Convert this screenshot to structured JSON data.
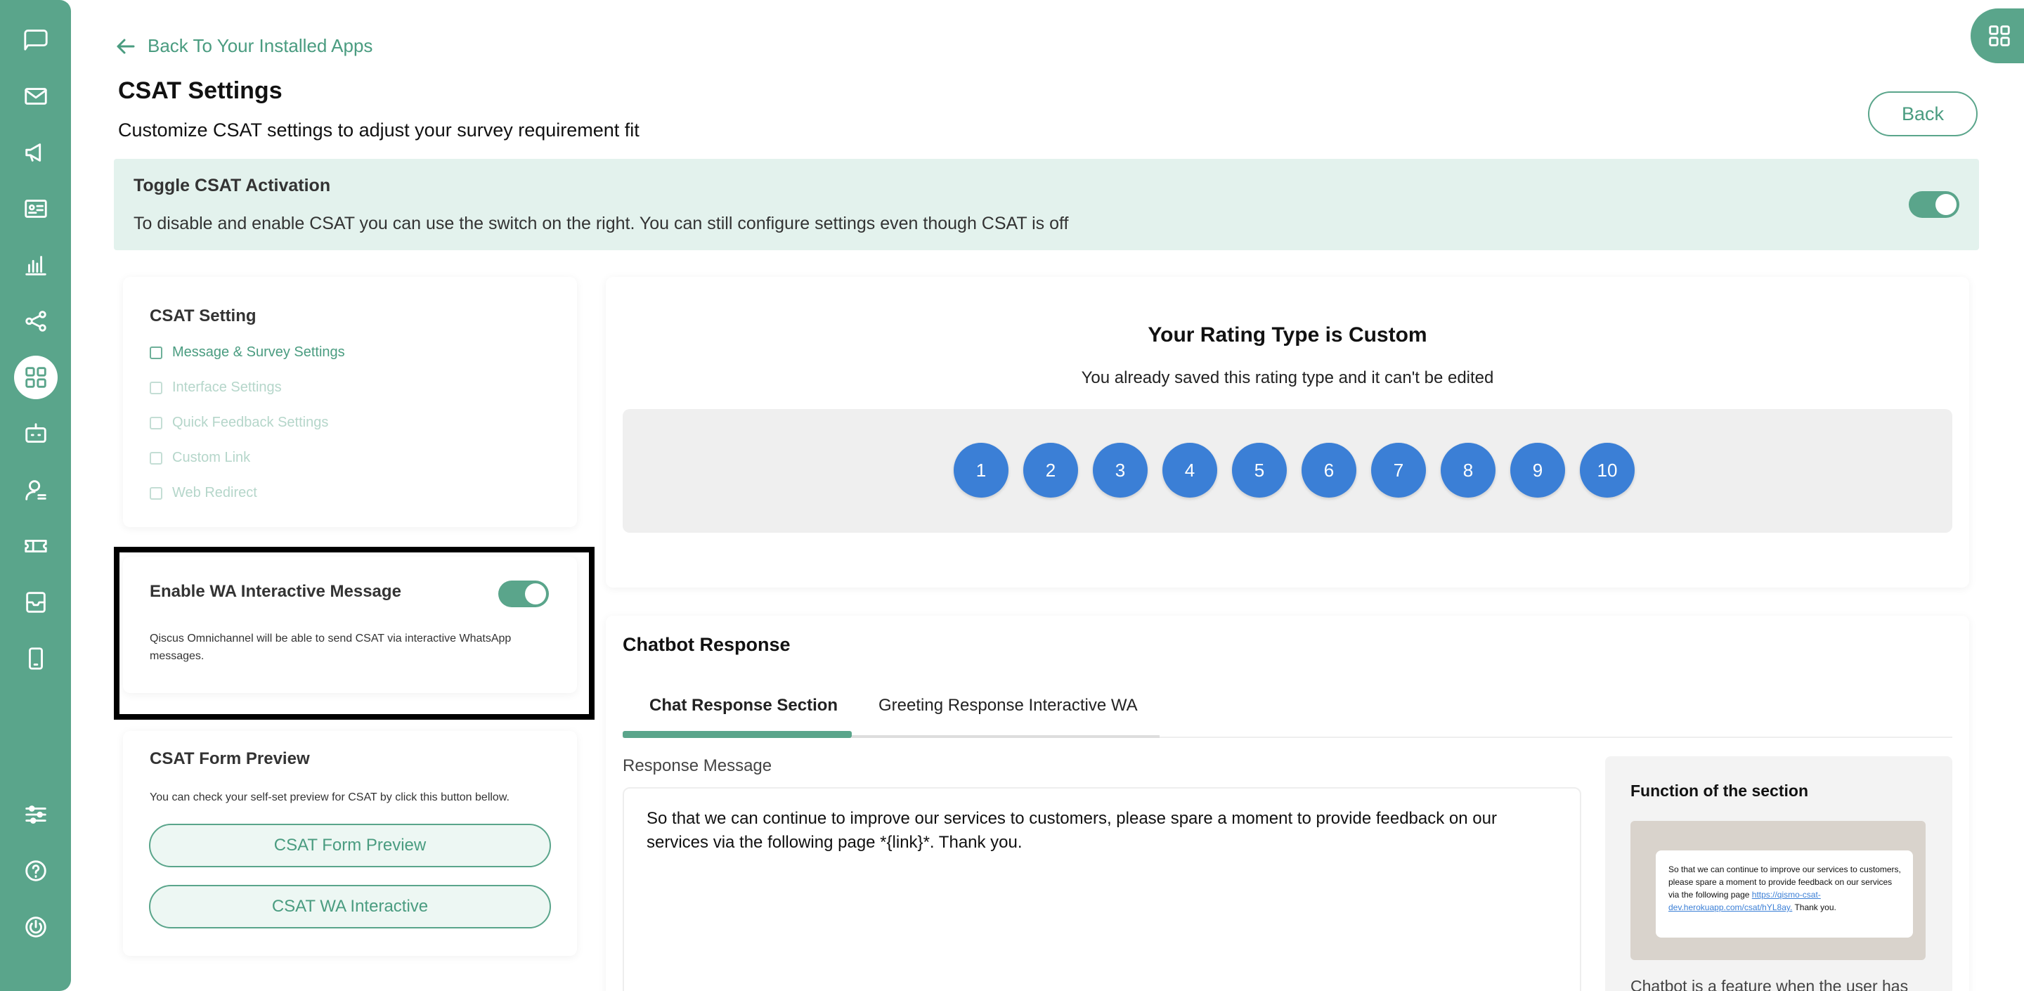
{
  "back_link": {
    "label": "Back To Your Installed Apps"
  },
  "page": {
    "title": "CSAT Settings",
    "subtitle": "Customize CSAT settings to adjust your survey requirement fit",
    "back_button": "Back"
  },
  "banner": {
    "title": "Toggle CSAT Activation",
    "description": "To disable and enable CSAT you can use the switch on the right. You can still configure settings even though CSAT is off",
    "toggle_on": true
  },
  "csat_setting": {
    "title": "CSAT Setting",
    "items": [
      {
        "label": "Message & Survey Settings",
        "active": true
      },
      {
        "label": "Interface Settings",
        "active": false
      },
      {
        "label": "Quick Feedback Settings",
        "active": false
      },
      {
        "label": "Custom Link",
        "active": false
      },
      {
        "label": "Web Redirect",
        "active": false
      }
    ]
  },
  "wa_interactive": {
    "title": "Enable WA Interactive Message",
    "description": "Qiscus Omnichannel will be able to send CSAT via interactive WhatsApp messages.",
    "toggle_on": true
  },
  "form_preview": {
    "title": "CSAT Form Preview",
    "description": "You can check your self-set preview for CSAT by click this button bellow.",
    "preview_button": "CSAT Form Preview",
    "wa_button": "CSAT WA Interactive"
  },
  "rating": {
    "title": "Your Rating Type is Custom",
    "subtitle": "You already saved this rating type and it can't be edited",
    "values": [
      "1",
      "2",
      "3",
      "4",
      "5",
      "6",
      "7",
      "8",
      "9",
      "10"
    ]
  },
  "chatbot": {
    "title": "Chatbot Response",
    "tabs": [
      "Chat Response Section",
      "Greeting Response Interactive WA"
    ],
    "active_tab": 0,
    "response_label": "Response Message",
    "response_text": "So that we can continue to improve our services to customers, please spare a moment to provide feedback on our services via the following page *{link}*. Thank you.",
    "function": {
      "title": "Function of the section",
      "preview_text": "So that we can continue to improve our services to customers, please spare a moment to provide feedback on our services via the following page",
      "preview_link": "https://qismo-csat-dev.herokuapp.com/csat/hYL8ay.",
      "preview_suffix": "Thank you.",
      "footer": "Chatbot is a feature when the user has"
    }
  },
  "sidebar_icons": [
    "chat-icon",
    "mail-icon",
    "megaphone-icon",
    "contacts-icon",
    "analytics-icon",
    "integration-icon",
    "apps-icon",
    "bot-icon",
    "agent-icon",
    "ticket-icon",
    "inbox-icon",
    "mobile-icon",
    "settings-icon",
    "help-icon",
    "power-icon"
  ],
  "colors": {
    "brand": "#5aa58b",
    "rating": "#3b7fd6",
    "banner_bg": "#e3f2ed"
  }
}
